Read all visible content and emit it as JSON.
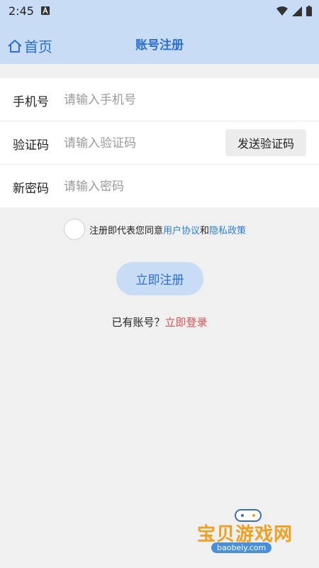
{
  "status": {
    "time": "2:45"
  },
  "appbar": {
    "back_label": "首页",
    "title": "账号注册"
  },
  "form": {
    "phone": {
      "label": "手机号",
      "placeholder": "请输入手机号"
    },
    "code": {
      "label": "验证码",
      "placeholder": "请输入验证码",
      "send_label": "发送验证码"
    },
    "password": {
      "label": "新密码",
      "placeholder": "请输入密码"
    }
  },
  "agreement": {
    "prefix": "注册即代表您同意",
    "user_agreement": "用户协议",
    "and": "和",
    "privacy_policy": "隐私政策"
  },
  "register_label": "立即注册",
  "login": {
    "prompt": "已有账号？",
    "link": "立即登录"
  },
  "watermark": {
    "name": "宝贝游戏网",
    "url": "baobeiy.com"
  }
}
